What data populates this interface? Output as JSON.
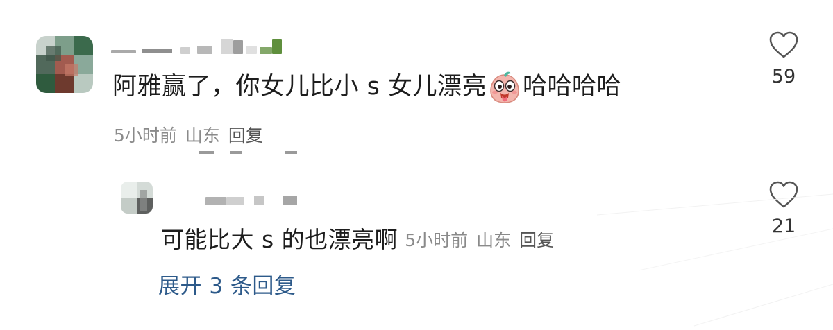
{
  "comment": {
    "text_before_emoji": "阿雅赢了，你女儿比小 s 女儿漂亮",
    "emoji_name": "drooling-face-emoji",
    "text_after_emoji": "哈哈哈哈",
    "time": "5小时前",
    "location": "山东",
    "reply_label": "回复",
    "like_count": "59"
  },
  "reply": {
    "text": "可能比大 s 的也漂亮啊",
    "time": "5小时前",
    "location": "山东",
    "reply_label": "回复",
    "like_count": "21"
  },
  "expand": {
    "label": "展开 3 条回复"
  },
  "colors": {
    "text": "#1d1d1d",
    "meta": "#8a8a8a",
    "link": "#2d5a8a",
    "heart_outline": "#555555"
  }
}
